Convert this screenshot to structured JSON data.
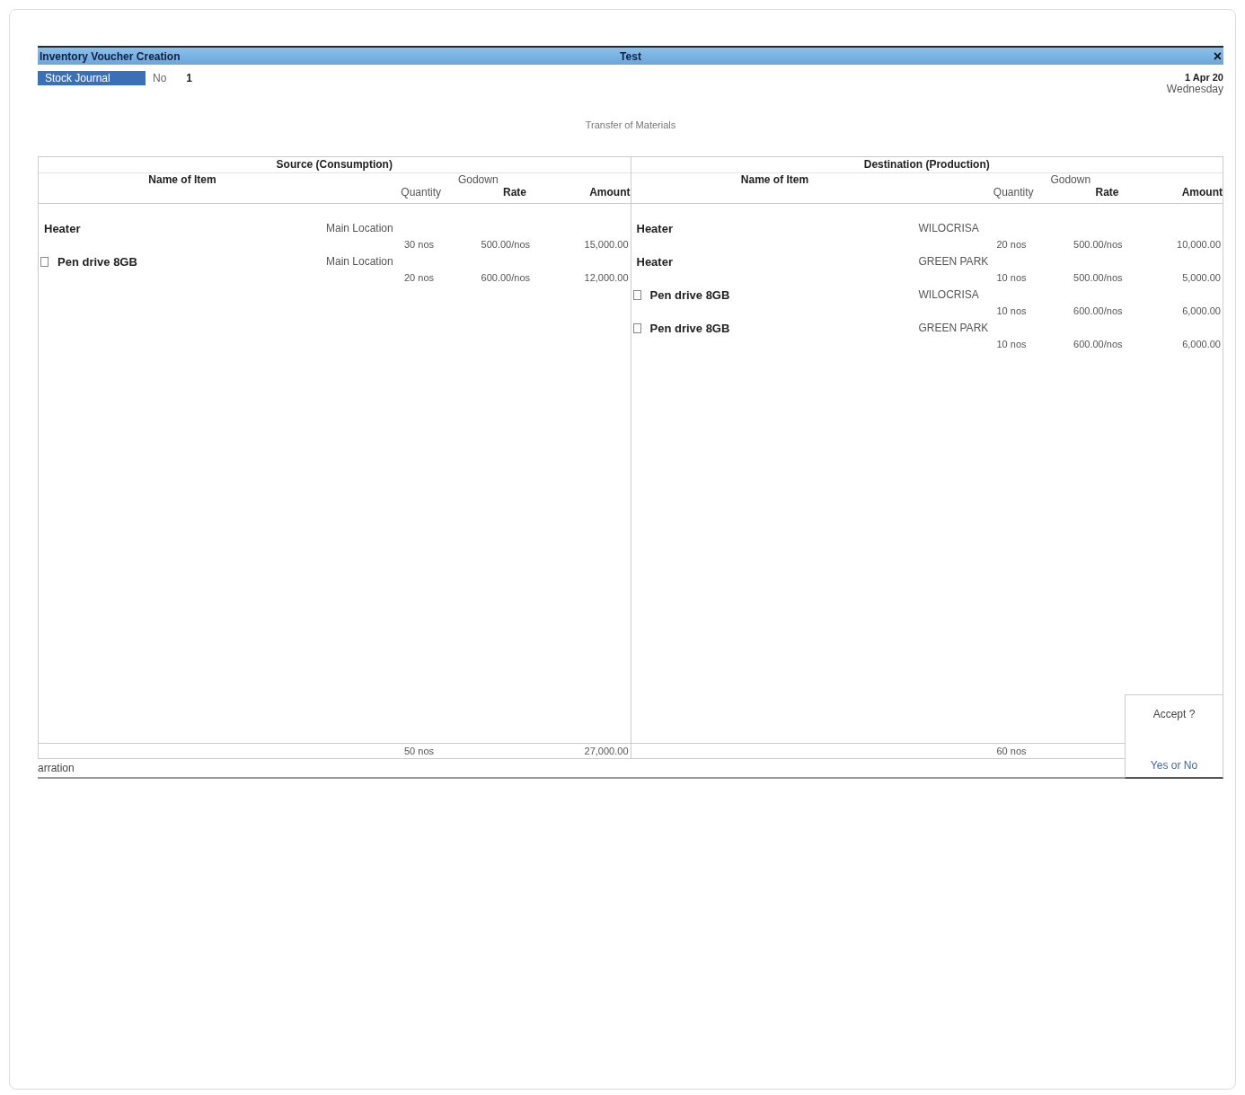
{
  "window": {
    "title": "Inventory Voucher Creation",
    "company": "Test",
    "close": "×"
  },
  "voucher": {
    "type": "Stock Journal",
    "number_label": "No",
    "number": "1",
    "date": "1 Apr 20",
    "day": "Wednesday",
    "voucher_class": "Transfer of Materials"
  },
  "sections": [
    {
      "title": "Source (Consumption)",
      "columns": {
        "name": "Name of Item",
        "godown": "Godown",
        "quantity": "Quantity",
        "rate": "Rate",
        "amount": "Amount"
      },
      "rows": [
        {
          "name": "Heater",
          "flag": false,
          "godown": "Main Location",
          "quantity": "30 nos",
          "rate": "500.00/nos",
          "amount": "15,000.00"
        },
        {
          "name": "Pen drive 8GB",
          "flag": true,
          "godown": "Main Location",
          "quantity": "20 nos",
          "rate": "600.00/nos",
          "amount": "12,000.00"
        }
      ],
      "total_quantity": "50 nos",
      "total_amount": "27,000.00"
    },
    {
      "title": "Destination (Production)",
      "columns": {
        "name": "Name of Item",
        "godown": "Godown",
        "quantity": "Quantity",
        "rate": "Rate",
        "amount": "Amount"
      },
      "rows": [
        {
          "name": "Heater",
          "flag": false,
          "godown": "WILOCRISA",
          "quantity": "20 nos",
          "rate": "500.00/nos",
          "amount": "10,000.00"
        },
        {
          "name": "Heater",
          "flag": false,
          "godown": "GREEN PARK",
          "quantity": "10 nos",
          "rate": "500.00/nos",
          "amount": "5,000.00"
        },
        {
          "name": "Pen drive 8GB",
          "flag": true,
          "godown": "WILOCRISA",
          "quantity": "10 nos",
          "rate": "600.00/nos",
          "amount": "6,000.00"
        },
        {
          "name": "Pen drive 8GB",
          "flag": true,
          "godown": "GREEN PARK",
          "quantity": "10 nos",
          "rate": "600.00/nos",
          "amount": "6,000.00"
        }
      ],
      "total_quantity": "60 nos"
    }
  ],
  "narration_label": "arration",
  "accept_dialog": {
    "prompt": "Accept ?",
    "options": "Yes or No"
  }
}
